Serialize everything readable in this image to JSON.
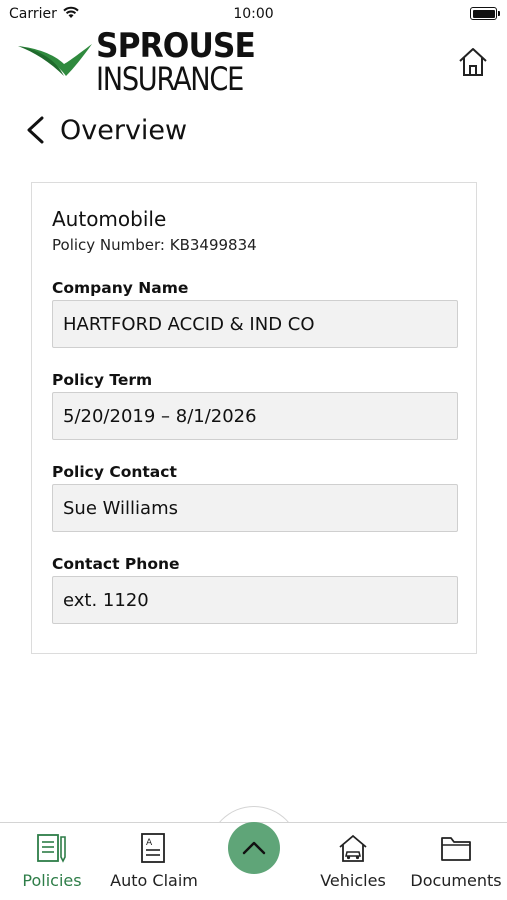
{
  "status_bar": {
    "carrier": "Carrier",
    "time": "10:00"
  },
  "header": {
    "logo_line1": "SPROUSE",
    "logo_line2": "INSURANCE",
    "back_title": "Overview"
  },
  "policy": {
    "title": "Automobile",
    "policy_number": "Policy Number: KB3499834",
    "fields": [
      {
        "label": "Company Name",
        "value": "HARTFORD ACCID & IND CO"
      },
      {
        "label": "Policy Term",
        "value": "5/20/2019 – 8/1/2026"
      },
      {
        "label": "Policy Contact",
        "value": "Sue Williams"
      },
      {
        "label": "Contact Phone",
        "value": "ext. 1120"
      }
    ]
  },
  "tabs": [
    {
      "label": "Policies",
      "icon": "policies-icon",
      "active": true
    },
    {
      "label": "Auto Claim",
      "icon": "auto-claim-icon",
      "active": false
    },
    {
      "label": "Vehicles",
      "icon": "vehicles-icon",
      "active": false
    },
    {
      "label": "Documents",
      "icon": "documents-icon",
      "active": false
    }
  ],
  "colors": {
    "brand_green": "#2e7d48",
    "center_button": "#5fa578",
    "field_bg": "#f2f2f2"
  }
}
